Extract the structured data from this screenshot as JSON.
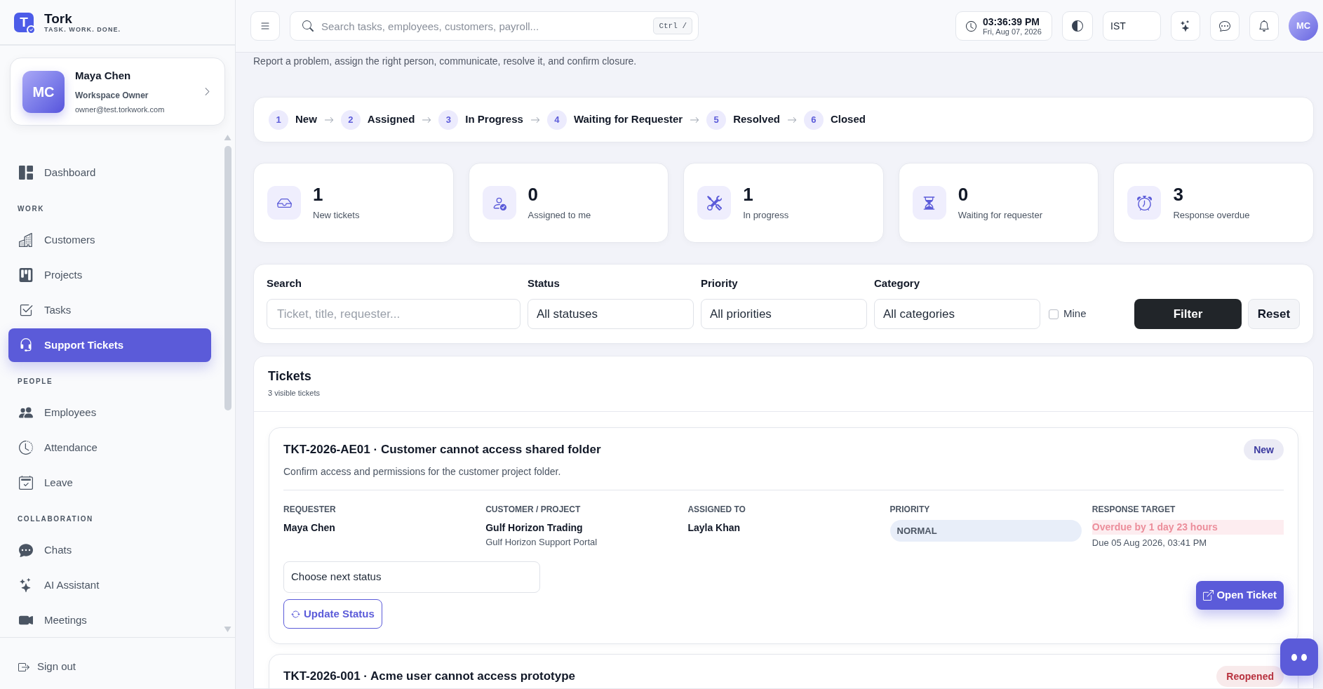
{
  "brand": {
    "logo_letter": "T",
    "name": "Tork",
    "tagline": "TASK. WORK. DONE."
  },
  "profile": {
    "initials": "MC",
    "name": "Maya Chen",
    "role": "Workspace Owner",
    "email": "owner@test.torkwork.com"
  },
  "sidebar": {
    "sections": [
      {
        "items": [
          {
            "label": "Dashboard",
            "selected": false
          }
        ]
      },
      {
        "title": "WORK",
        "items": [
          {
            "label": "Customers",
            "selected": false
          },
          {
            "label": "Projects",
            "selected": false
          },
          {
            "label": "Tasks",
            "selected": false
          },
          {
            "label": "Support Tickets",
            "selected": true
          }
        ]
      },
      {
        "title": "PEOPLE",
        "items": [
          {
            "label": "Employees",
            "selected": false
          },
          {
            "label": "Attendance",
            "selected": false
          },
          {
            "label": "Leave",
            "selected": false
          }
        ]
      },
      {
        "title": "COLLABORATION",
        "items": [
          {
            "label": "Chats",
            "selected": false
          },
          {
            "label": "AI Assistant",
            "selected": false
          },
          {
            "label": "Meetings",
            "selected": false
          }
        ]
      }
    ],
    "sign_out": "Sign out"
  },
  "topbar": {
    "search": {
      "placeholder": "Search tasks, employees, customers, payroll...",
      "shortcut": "Ctrl /"
    },
    "clock": {
      "time": "03:36:39 PM",
      "date": "Fri, Aug 07, 2026"
    },
    "timezone": "IST",
    "avatar": "MC"
  },
  "page": {
    "subtitle": "Report a problem, assign the right person, communicate, resolve it, and confirm closure."
  },
  "workflow_steps": [
    {
      "number": "1",
      "label": "New"
    },
    {
      "number": "2",
      "label": "Assigned"
    },
    {
      "number": "3",
      "label": "In Progress"
    },
    {
      "number": "4",
      "label": "Waiting for Requester"
    },
    {
      "number": "5",
      "label": "Resolved"
    },
    {
      "number": "6",
      "label": "Closed"
    }
  ],
  "stats": [
    {
      "value": "1",
      "label": "New tickets"
    },
    {
      "value": "0",
      "label": "Assigned to me"
    },
    {
      "value": "1",
      "label": "In progress"
    },
    {
      "value": "0",
      "label": "Waiting for requester"
    },
    {
      "value": "3",
      "label": "Response overdue"
    }
  ],
  "filters": {
    "search": {
      "label": "Search",
      "placeholder": "Ticket, title, requester..."
    },
    "selects": [
      {
        "label": "Status",
        "value": "All statuses"
      },
      {
        "label": "Priority",
        "value": "All priorities"
      },
      {
        "label": "Category",
        "value": "All categories"
      }
    ],
    "mine": {
      "label": "Mine",
      "checked": false
    },
    "buttons": [
      {
        "label": "Filter",
        "kind": "primary"
      },
      {
        "label": "Reset",
        "kind": "secondary"
      }
    ]
  },
  "tickets": {
    "title": "Tickets",
    "subtitle": "3 visible tickets",
    "items": [
      {
        "heading": "TKT-2026-AE01 · Customer cannot access shared folder",
        "description": "Confirm access and permissions for the customer project folder.",
        "badge": {
          "label": "New",
          "color": "#3b3aa0"
        },
        "fields": [
          {
            "label": "REQUESTER",
            "value": "Maya Chen",
            "kind": "text"
          },
          {
            "label": "CUSTOMER / PROJECT",
            "value": "Gulf Horizon Trading",
            "kind": "text",
            "detail": "Gulf Horizon Support Portal"
          },
          {
            "label": "ASSIGNED TO",
            "value": "Layla Khan",
            "kind": "text"
          },
          {
            "label": "PRIORITY",
            "value": "NORMAL",
            "kind": "pill"
          },
          {
            "label": "RESPONSE TARGET",
            "value": "Overdue by 1 day 23 hours",
            "kind": "alert",
            "detail": "Due 05 Aug 2026, 03:41 PM"
          }
        ],
        "next_status": {
          "value": "Choose next status"
        },
        "update_button": "Update Status",
        "open_button": "Open Ticket"
      },
      {
        "heading": "TKT-2026-001 · Acme user cannot access prototype",
        "badge": {
          "label": "Reopened",
          "color": "#b8323f"
        }
      }
    ]
  }
}
